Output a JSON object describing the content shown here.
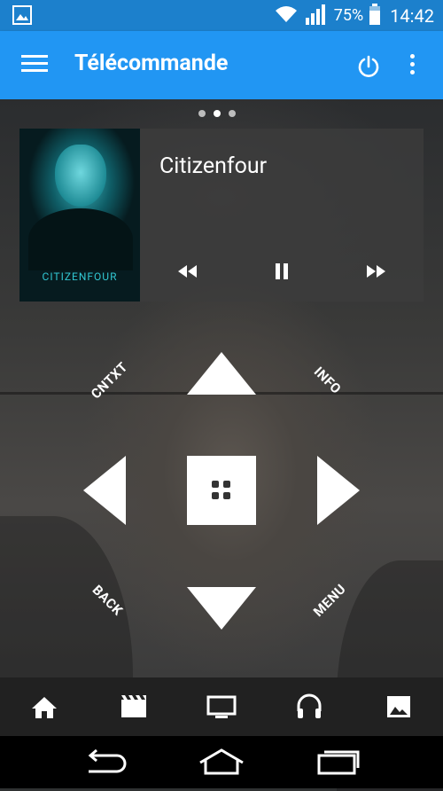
{
  "status_bar": {
    "battery": "75%",
    "time": "14:42",
    "icons": [
      "image-notification-icon",
      "wifi-icon",
      "signal-icon",
      "battery-icon"
    ]
  },
  "app_bar": {
    "title": "Télécommande",
    "icons": [
      "menu-icon",
      "power-icon",
      "overflow-icon"
    ],
    "color": "#2196f3"
  },
  "pager": {
    "pages": 3,
    "active_page": 2
  },
  "now_playing": {
    "title": "Citizenfour",
    "poster_text": "CITIZENFOUR",
    "controls": [
      "rewind-icon",
      "pause-icon",
      "fast-forward-icon"
    ]
  },
  "remote": {
    "cntxt_label": "CNTXT",
    "info_label": "INFO",
    "back_label": "BACK",
    "menu_label": "MENU",
    "dpad": [
      "up-arrow-icon",
      "down-arrow-icon",
      "left-arrow-icon",
      "right-arrow-icon",
      "select-icon"
    ]
  },
  "tabs": [
    "home-icon",
    "movies-icon",
    "tv-icon",
    "music-icon",
    "pictures-icon"
  ],
  "nav_bar": [
    "back-icon",
    "home-nav-icon",
    "recents-icon"
  ]
}
